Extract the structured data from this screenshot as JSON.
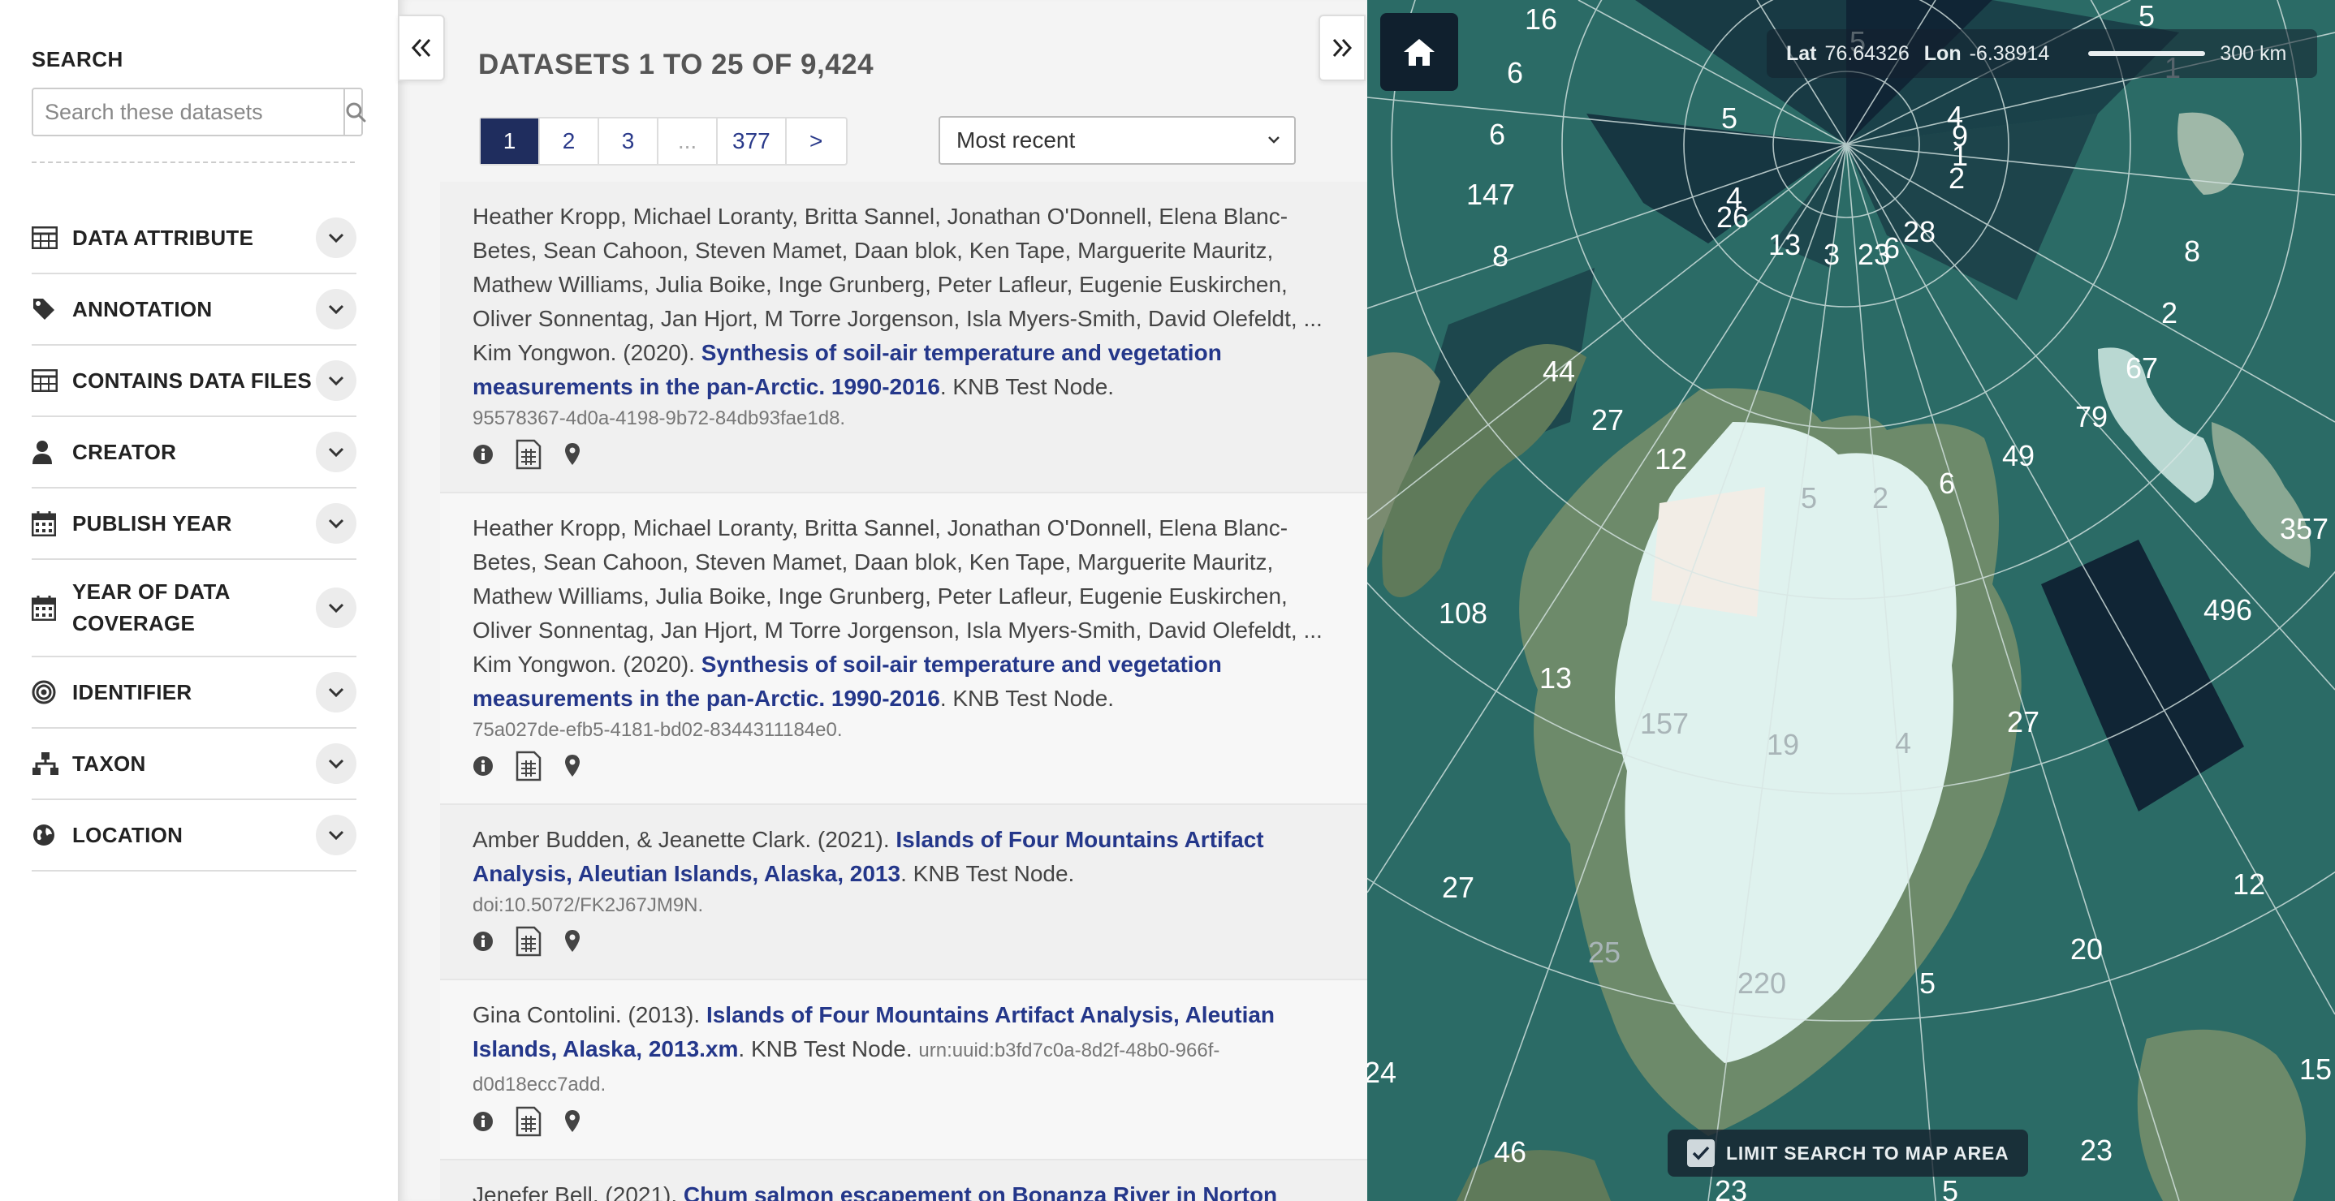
{
  "sidebar": {
    "search_heading": "SEARCH",
    "search_placeholder": "Search these datasets",
    "filters": [
      {
        "label": "DATA ATTRIBUTE",
        "icon": "table-icon"
      },
      {
        "label": "ANNOTATION",
        "icon": "tag-icon"
      },
      {
        "label": "CONTAINS DATA FILES",
        "icon": "table-icon"
      },
      {
        "label": "CREATOR",
        "icon": "user-icon"
      },
      {
        "label": "PUBLISH YEAR",
        "icon": "calendar-icon"
      },
      {
        "label": "YEAR OF DATA COVERAGE",
        "icon": "calendar-icon"
      },
      {
        "label": "IDENTIFIER",
        "icon": "bullseye-icon"
      },
      {
        "label": "TAXON",
        "icon": "sitemap-icon"
      },
      {
        "label": "LOCATION",
        "icon": "globe-icon"
      }
    ]
  },
  "results": {
    "title": "DATASETS 1 TO 25 OF 9,424",
    "pager": [
      "1",
      "2",
      "3",
      "...",
      "377",
      ">"
    ],
    "pager_active": "1",
    "sort_value": "Most recent",
    "items": [
      {
        "authors": "Heather Kropp, Michael Loranty, Britta Sannel, Jonathan O'Donnell, Elena Blanc-Betes, Sean Cahoon, Steven Mamet, Daan blok, Ken Tape, Marguerite Mauritz, Mathew Williams, Julia Boike, Inge Grunberg, Peter Lafleur, Eugenie Euskirchen, Oliver Sonnentag, Jan Hjort, M Torre Jorgenson, Isla Myers-Smith, David Olefeldt, ... Kim Yongwon. (2020). ",
        "title": "Synthesis of soil-air temperature and vegetation measurements in the pan-Arctic. 1990-2016",
        "node": ". KNB Test Node.",
        "pid": "95578367-4d0a-4198-9b72-84db93fae1d8."
      },
      {
        "authors": "Heather Kropp, Michael Loranty, Britta Sannel, Jonathan O'Donnell, Elena Blanc-Betes, Sean Cahoon, Steven Mamet, Daan blok, Ken Tape, Marguerite Mauritz, Mathew Williams, Julia Boike, Inge Grunberg, Peter Lafleur, Eugenie Euskirchen, Oliver Sonnentag, Jan Hjort, M Torre Jorgenson, Isla Myers-Smith, David Olefeldt, ... Kim Yongwon. (2020). ",
        "title": "Synthesis of soil-air temperature and vegetation measurements in the pan-Arctic. 1990-2016",
        "node": ". KNB Test Node.",
        "pid": "75a027de-efb5-4181-bd02-8344311184e0."
      },
      {
        "authors": "Amber Budden, & Jeanette Clark. (2021). ",
        "title": "Islands of Four Mountains Artifact Analysis, Aleutian Islands, Alaska, 2013",
        "node": ". KNB Test Node.",
        "pid": "doi:10.5072/FK2J67JM9N."
      },
      {
        "authors": "Gina Contolini. (2013). ",
        "title": "Islands of Four Mountains Artifact Analysis, Aleutian Islands, Alaska, 2013.xm",
        "node": ". KNB Test Node. ",
        "pid": "urn:uuid:b3fd7c0a-8d2f-48b0-966f-d0d18ecc7add."
      },
      {
        "authors": "Jenefer Bell. (2021). ",
        "title": "Chum salmon escapement on Bonanza River in Norton",
        "node": "",
        "pid": ""
      }
    ]
  },
  "map": {
    "lat_label": "Lat",
    "lat_value": "76.64326",
    "lon_label": "Lon",
    "lon_value": "-6.38914",
    "scale_label": "300 km",
    "limit_label": "LIMIT SEARCH TO MAP AREA",
    "limit_checked": true,
    "counts": [
      "16",
      "5",
      "6",
      "5",
      "4",
      "9",
      "1",
      "2",
      "6",
      "147",
      "8",
      "4",
      "26",
      "13",
      "3",
      "23",
      "6",
      "28",
      "8",
      "2",
      "67",
      "44",
      "27",
      "12",
      "5",
      "2",
      "6",
      "49",
      "79",
      "357",
      "108",
      "496",
      "13",
      "157",
      "19",
      "4",
      "27",
      "27",
      "12",
      "25",
      "220",
      "5",
      "20",
      "24",
      "15",
      "46",
      "23",
      "23",
      "5",
      "5",
      "1"
    ]
  },
  "colors": {
    "accent": "#1f2d5e",
    "link": "#24378a",
    "map_ocean": "#2b6b66",
    "map_grid_dark": "#0e1e30",
    "ice": "#dff2ee"
  }
}
